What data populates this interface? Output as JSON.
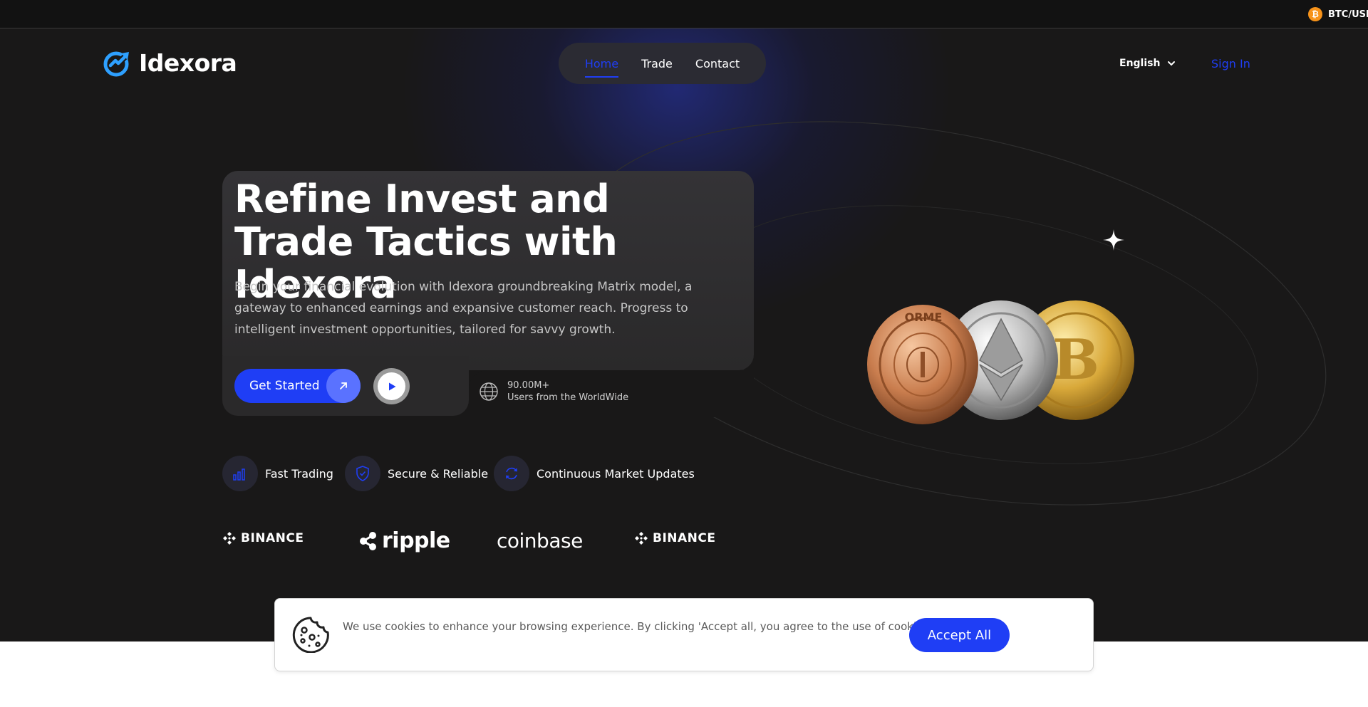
{
  "ticker": {
    "pair": "BTC/USI"
  },
  "brand": {
    "name": "Idexora",
    "accent": "#1f3ef5",
    "logo_color": "#2ea0ff"
  },
  "nav": {
    "items": [
      {
        "label": "Home",
        "active": true
      },
      {
        "label": "Trade",
        "active": false
      },
      {
        "label": "Contact",
        "active": false
      }
    ]
  },
  "header": {
    "language": "English",
    "signin": "Sign In"
  },
  "hero": {
    "title": "Refine Invest and Trade Tactics with Idexora",
    "description": "Begin your financial evolution with Idexora groundbreaking Matrix model, a gateway to enhanced earnings and expansive customer reach. Progress to intelligent investment opportunities, tailored for savvy growth.",
    "cta": "Get Started",
    "users_count": "90.00M+",
    "users_label": "Users from the WorldWide"
  },
  "features": [
    {
      "label": "Fast Trading",
      "icon": "bar-chart-icon"
    },
    {
      "label": "Secure & Reliable",
      "icon": "shield-icon"
    },
    {
      "label": "Continuous Market Updates",
      "icon": "refresh-icon"
    }
  ],
  "partners": [
    {
      "name": "BINANCE"
    },
    {
      "name": "ripple"
    },
    {
      "name": "coinbase"
    },
    {
      "name": "BINANCE"
    }
  ],
  "coins": {
    "left_coin_text": "ORME"
  },
  "cookie": {
    "text": "We use cookies to enhance your browsing experience. By clicking 'Accept all, you agree to the use of cookies.",
    "accept": "Accept All"
  }
}
